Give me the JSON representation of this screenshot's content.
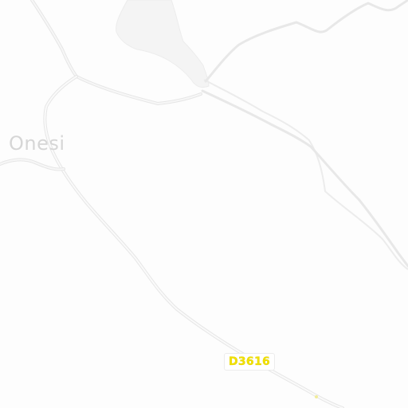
{
  "map": {
    "place_label": "Onesi",
    "road_ref": "D3616",
    "colors": {
      "background": "#fdfdfd",
      "water": "#f4f4f4",
      "road": "#efefef",
      "road_casing": "#e6e6e6",
      "label": "#d6d6d6",
      "shield_text": "#f2e100"
    }
  }
}
